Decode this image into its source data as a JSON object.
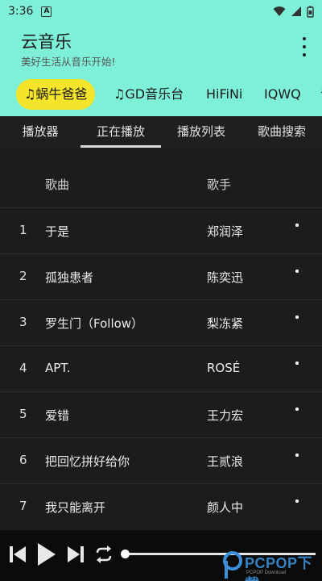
{
  "status_bar": {
    "time": "3:36",
    "notification_icon": "A"
  },
  "app_bar": {
    "title": "云音乐",
    "subtitle": "美好生活从音乐开始!"
  },
  "sources": [
    {
      "label": "♫蜗牛爸爸",
      "active": true
    },
    {
      "label": "♫GD音乐台",
      "active": false
    },
    {
      "label": "HiFiNi",
      "active": false
    },
    {
      "label": "IQWQ",
      "active": false
    }
  ],
  "tabs": [
    {
      "label": "播放器",
      "active": false
    },
    {
      "label": "正在播放",
      "active": true
    },
    {
      "label": "播放列表",
      "active": false
    },
    {
      "label": "歌曲搜索",
      "active": false
    }
  ],
  "table": {
    "headers": {
      "song": "歌曲",
      "artist": "歌手"
    },
    "rows": [
      {
        "num": "1",
        "song": "于是",
        "artist": "郑润泽"
      },
      {
        "num": "2",
        "song": "孤独患者",
        "artist": "陈奕迅"
      },
      {
        "num": "3",
        "song": "罗生门（Follow）",
        "artist": "梨冻紧"
      },
      {
        "num": "4",
        "song": "APT.",
        "artist": "ROSÉ"
      },
      {
        "num": "5",
        "song": "爱错",
        "artist": "王力宏"
      },
      {
        "num": "6",
        "song": "把回忆拼好给你",
        "artist": "王贰浪"
      },
      {
        "num": "7",
        "song": "我只能离开",
        "artist": "颜人中"
      }
    ]
  },
  "player": {
    "progress": 0.0
  },
  "watermark": {
    "text": "PCPOP下载",
    "sub": "PCPOP Download"
  },
  "colors": {
    "header_bg": "#7ef0d8",
    "active_source_bg": "#f5e52a",
    "list_bg": "#1c1c1e"
  }
}
